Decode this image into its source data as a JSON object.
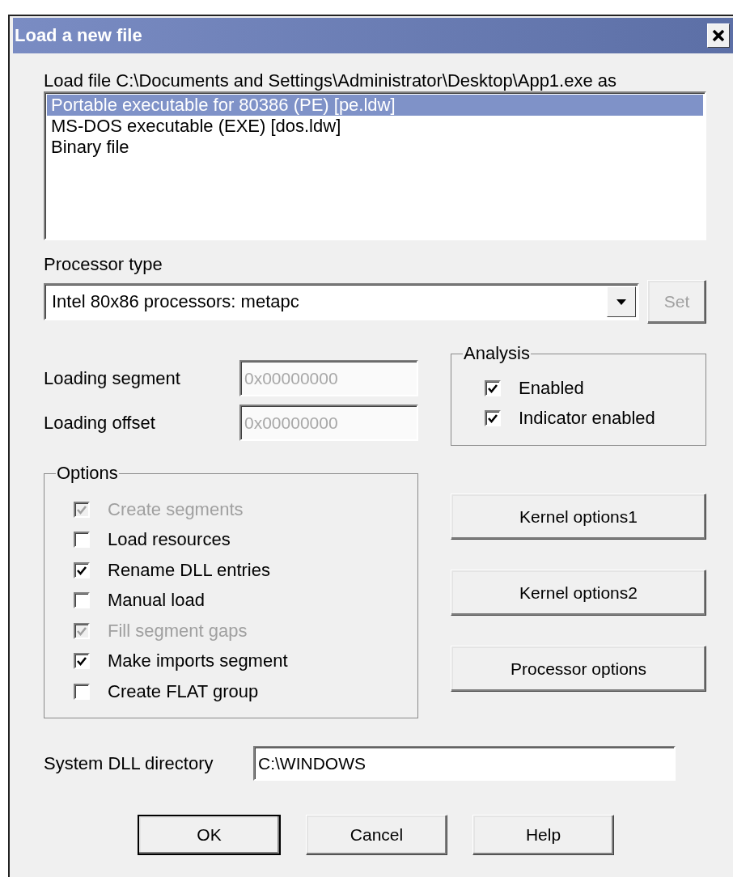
{
  "window": {
    "title": "Load a new file"
  },
  "load_file_label": "Load file C:\\Documents and Settings\\Administrator\\Desktop\\App1.exe as",
  "formats": [
    {
      "label": "Portable executable for 80386 (PE) [pe.ldw]",
      "selected": true
    },
    {
      "label": "MS-DOS executable (EXE) [dos.ldw]",
      "selected": false
    },
    {
      "label": "Binary file",
      "selected": false
    }
  ],
  "processor": {
    "label": "Processor type",
    "value": "Intel 80x86 processors: metapc",
    "set_button": {
      "label": "Set",
      "disabled": true
    }
  },
  "loading": [
    {
      "label": "Loading segment",
      "value": "0x00000000",
      "disabled": true
    },
    {
      "label": "Loading offset",
      "value": "0x00000000",
      "disabled": true
    }
  ],
  "analysis": {
    "title": "Analysis",
    "items": [
      {
        "label": "Enabled",
        "checked": true,
        "disabled": false
      },
      {
        "label": "Indicator enabled",
        "checked": true,
        "disabled": false
      }
    ]
  },
  "options": {
    "title": "Options",
    "items": [
      {
        "label": "Create segments",
        "checked": true,
        "disabled": true
      },
      {
        "label": "Load resources",
        "checked": false,
        "disabled": false
      },
      {
        "label": "Rename DLL entries",
        "checked": true,
        "disabled": false
      },
      {
        "label": "Manual load",
        "checked": false,
        "disabled": false
      },
      {
        "label": "Fill segment gaps",
        "checked": true,
        "disabled": true
      },
      {
        "label": "Make imports segment",
        "checked": true,
        "disabled": false
      },
      {
        "label": "Create FLAT group",
        "checked": false,
        "disabled": false
      }
    ]
  },
  "side_buttons": [
    {
      "label": "Kernel options1"
    },
    {
      "label": "Kernel options2"
    },
    {
      "label": "Processor options"
    }
  ],
  "system_dll": {
    "label": "System DLL directory",
    "value": "C:\\WINDOWS"
  },
  "buttons": [
    {
      "label": "OK",
      "default": true
    },
    {
      "label": "Cancel",
      "default": false
    },
    {
      "label": "Help",
      "default": false
    }
  ]
}
